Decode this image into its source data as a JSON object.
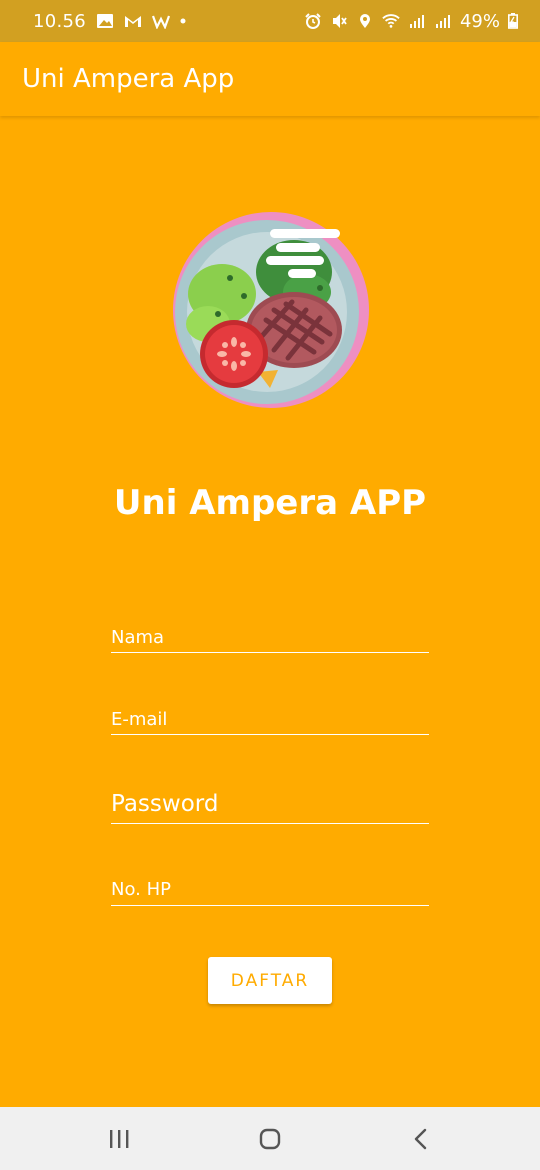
{
  "status_bar": {
    "time": "10.56",
    "battery": "49%",
    "left_icons": [
      "gallery-icon",
      "gmail-icon",
      "w-app-icon",
      "dot-icon"
    ],
    "right_icons": [
      "alarm-icon",
      "mute-icon",
      "location-icon",
      "wifi-icon",
      "signal-icon",
      "signal-icon",
      "battery-charging-icon"
    ]
  },
  "app_bar": {
    "title": "Uni Ampera App"
  },
  "main": {
    "logo_icon": "food-plate-icon",
    "heading": "Uni Ampera APP"
  },
  "form": {
    "name_placeholder": "Nama",
    "email_placeholder": "E-mail",
    "password_placeholder": "Password",
    "phone_placeholder": "No. HP",
    "submit_label": "DAFTAR"
  },
  "nav_bar": {
    "icons": [
      "recent-apps-icon",
      "home-icon",
      "back-icon"
    ]
  },
  "colors": {
    "primary": "#FFAB00",
    "status_bar": "#D2A021",
    "nav_bar": "#F0F0F0",
    "text_on_primary": "#FFFFFF"
  }
}
